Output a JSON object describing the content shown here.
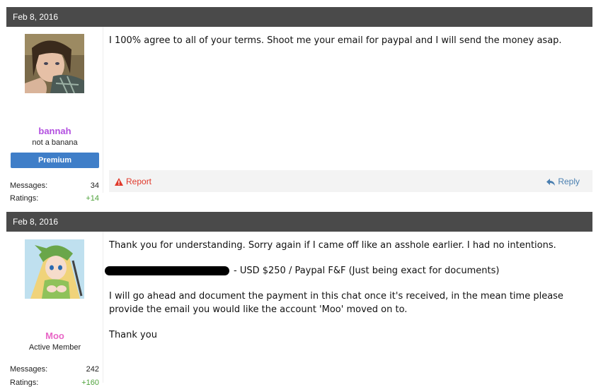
{
  "posts": [
    {
      "date": "Feb 8, 2016",
      "username": "bannah",
      "username_color": "#b24fe0",
      "usertitle": "not a banana",
      "badge": "Premium",
      "stats": [
        {
          "label": "Messages:",
          "value": "34"
        },
        {
          "label": "Ratings:",
          "value": "+14"
        }
      ],
      "message": "I 100% agree to all of your terms. Shoot me your email for paypal and I will send the money asap.",
      "actions": {
        "report": "Report",
        "reply": "Reply"
      }
    },
    {
      "date": "Feb 8, 2016",
      "username": "Moo",
      "username_color": "#e866c6",
      "usertitle": "Active Member",
      "stats": [
        {
          "label": "Messages:",
          "value": "242"
        },
        {
          "label": "Ratings:",
          "value": "+160"
        }
      ],
      "lines": [
        "Thank you for understanding. Sorry again if I came off like an asshole earlier. I had no intentions.",
        "- USD $250 / Paypal F&F (Just being exact for documents)",
        "I will go ahead and document the payment in this chat once it's received, in the mean time please provide the email you would like the account 'Moo' moved on to.",
        "Thank you"
      ]
    }
  ],
  "icons": {
    "report": "warning-icon",
    "reply": "reply-arrow-icon"
  },
  "colors": {
    "header_bg": "#4a4a4a",
    "badge_bg": "#3f7ec8",
    "report": "#e0392b",
    "reply": "#4a7fb0",
    "rating_positive": "#4fa23b"
  }
}
